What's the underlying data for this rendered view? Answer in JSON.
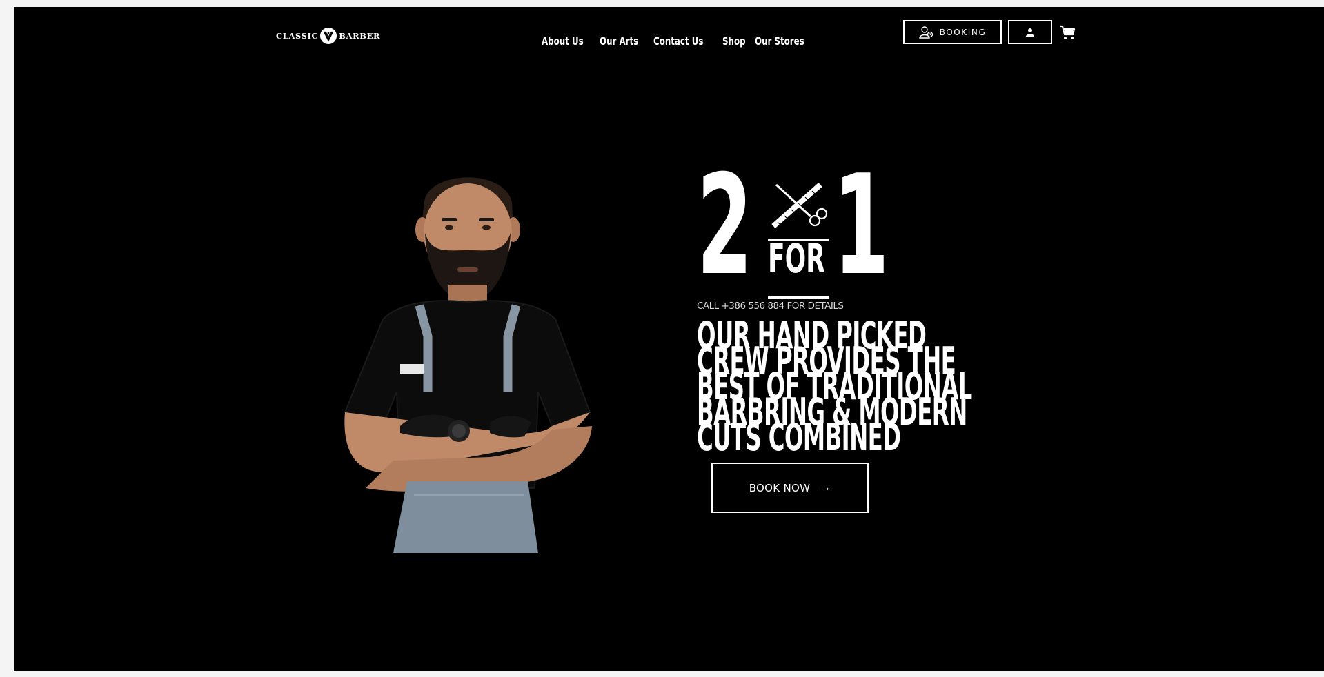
{
  "header": {
    "logo": {
      "left_word": "CLASSIC",
      "right_word": "BARBER",
      "emblem_icon": "barber-crest-emblem-icon"
    },
    "nav": [
      {
        "label": "About Us"
      },
      {
        "label": "Our Arts"
      },
      {
        "label": "Contact Us"
      },
      {
        "label": "Shop"
      },
      {
        "label": "Our Stores"
      }
    ],
    "booking": {
      "label": "BOOKING",
      "icon": "booking-people-icon"
    },
    "account": {
      "icon": "user-icon"
    },
    "cart": {
      "icon": "cart-icon"
    }
  },
  "hero": {
    "promo": {
      "left_digit": "2",
      "right_digit": "1",
      "middle": "FOR",
      "icon": "scissors-comb-icon"
    },
    "call": "CALL +386 556 884 FOR DETAILS",
    "headline_lines": [
      "OUR HAND PICKED",
      "CREW PROVIDES THE",
      "BEST OF TRADITIONAL",
      "BARBRING & MODERN",
      "CUTS COMBINED"
    ],
    "cta": {
      "label": "BOOK NOW",
      "arrow": "→"
    },
    "image": "barber-portrait-photo"
  },
  "colors": {
    "background": "#000000",
    "text": "#ffffff",
    "page_margin": "#f4f4f4"
  }
}
